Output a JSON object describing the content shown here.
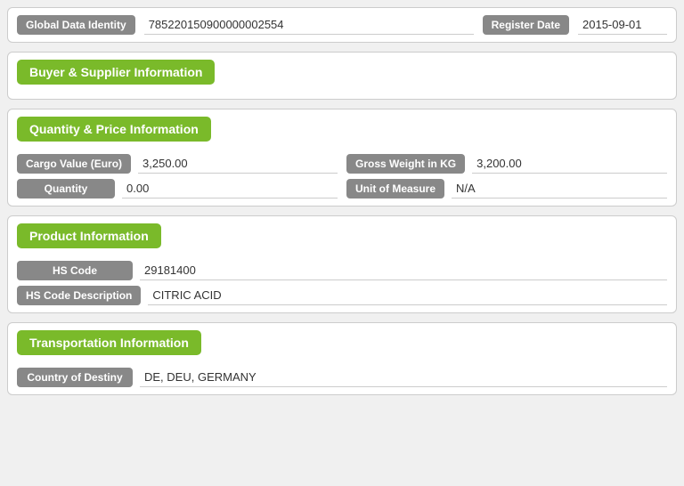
{
  "header": {
    "global_data_identity_label": "Global Data Identity",
    "global_data_identity_value": "785220150900000002554",
    "register_date_label": "Register Date",
    "register_date_value": "2015-09-01"
  },
  "buyer_supplier": {
    "section_title": "Buyer & Supplier Information"
  },
  "quantity_price": {
    "section_title": "Quantity & Price Information",
    "cargo_value_label": "Cargo Value (Euro)",
    "cargo_value": "3,250.00",
    "gross_weight_label": "Gross Weight in KG",
    "gross_weight": "3,200.00",
    "quantity_label": "Quantity",
    "quantity_value": "0.00",
    "unit_of_measure_label": "Unit of Measure",
    "unit_of_measure_value": "N/A"
  },
  "product": {
    "section_title": "Product Information",
    "hs_code_label": "HS Code",
    "hs_code_value": "29181400",
    "hs_code_desc_label": "HS Code Description",
    "hs_code_desc_value": "CITRIC ACID"
  },
  "transportation": {
    "section_title": "Transportation Information",
    "country_of_destiny_label": "Country of Destiny",
    "country_of_destiny_value": "DE, DEU, GERMANY"
  }
}
